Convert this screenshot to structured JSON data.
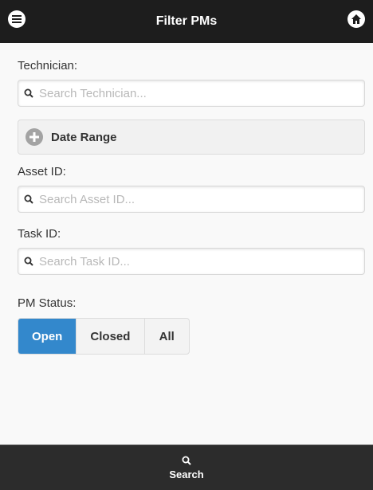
{
  "header": {
    "title": "Filter PMs",
    "menu_icon": "menu-icon",
    "home_icon": "home-icon"
  },
  "form": {
    "technician": {
      "label": "Technician:",
      "placeholder": "Search Technician..."
    },
    "date_range": {
      "label": "Date Range",
      "icon": "plus-icon"
    },
    "asset": {
      "label": "Asset ID:",
      "placeholder": "Search Asset ID..."
    },
    "task": {
      "label": "Task ID:",
      "placeholder": "Search Task ID..."
    },
    "pm_status": {
      "label": "PM Status:",
      "options": [
        "Open",
        "Closed",
        "All"
      ],
      "selected": "Open"
    }
  },
  "footer": {
    "search_label": "Search",
    "icon": "search-icon"
  },
  "colors": {
    "header_bg": "#1d1d1d",
    "active": "#3388cc",
    "footer_bg": "#2c2c2c"
  }
}
